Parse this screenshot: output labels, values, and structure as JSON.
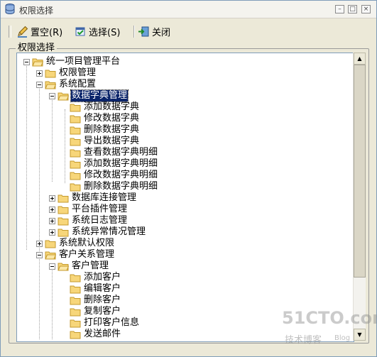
{
  "window": {
    "title": "权限选择",
    "minimize_glyph": "–",
    "maximize_glyph": "□",
    "close_glyph": "×"
  },
  "toolbar": {
    "clear_label": "置空(R)",
    "select_label": "选择(S)",
    "close_label": "关闭"
  },
  "groupbox": {
    "label": "权限选择"
  },
  "tree": {
    "root": "统一项目管理平台",
    "permission_mgmt": "权限管理",
    "system_config": "系统配置",
    "data_dict_mgmt": "数据字典管理",
    "dict_children": [
      "添加数据字典",
      "修改数据字典",
      "删除数据字典",
      "导出数据字典",
      "查看数据字典明细",
      "添加数据字典明细",
      "修改数据字典明细",
      "删除数据字典明细"
    ],
    "db_conn_mgmt": "数据库连接管理",
    "plugin_mgmt": "平台插件管理",
    "log_mgmt": "系统日志管理",
    "exception_mgmt": "系统异常情况管理",
    "default_perm": "系统默认权限",
    "crm": "客户关系管理",
    "customer_mgmt": "客户管理",
    "customer_children": [
      "添加客户",
      "编辑客户",
      "删除客户",
      "复制客户",
      "打印客户信息",
      "发送邮件"
    ]
  },
  "watermark": {
    "brand": "51CTO.com",
    "tagline": "技术博客",
    "tag": "Blog"
  }
}
